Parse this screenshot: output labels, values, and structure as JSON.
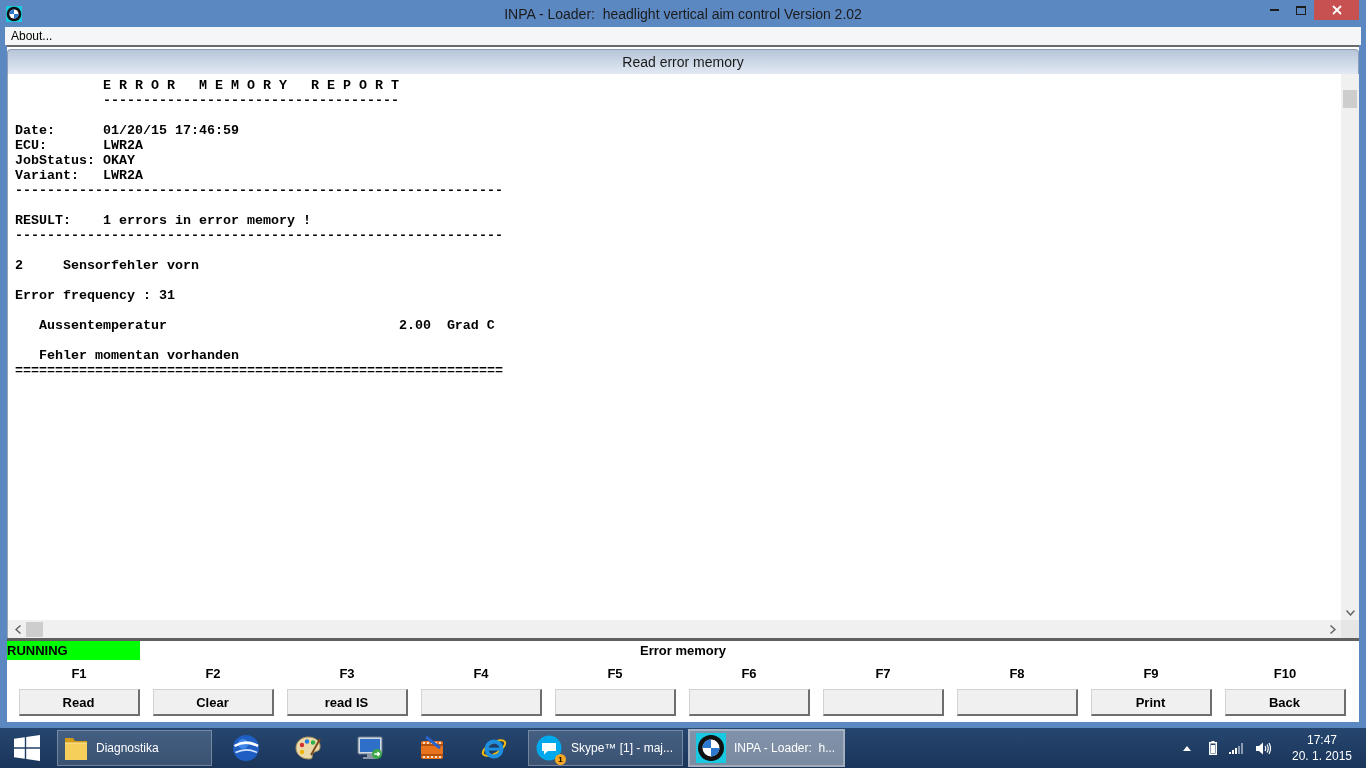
{
  "window": {
    "title": "INPA - Loader:  headlight vertical aim control Version 2.02"
  },
  "menu": [
    "About..."
  ],
  "panel": {
    "title": "Read error memory"
  },
  "report": {
    "title": "E R R O R   M E M O R Y   R E P O R T",
    "title_underline": "-------------------------------------",
    "fields": [
      {
        "label": "Date:",
        "value": "01/20/15 17:46:59"
      },
      {
        "label": "ECU:",
        "value": "LWR2A"
      },
      {
        "label": "JobStatus:",
        "value": "OKAY"
      },
      {
        "label": "Variant:",
        "value": "LWR2A"
      }
    ],
    "separator_1": "-------------------------------------------------------------",
    "result": {
      "label": "RESULT:",
      "value": "1 errors in error memory !"
    },
    "separator_2": "-------------------------------------------------------------",
    "error": {
      "code": "2",
      "name": "Sensorfehler vorn"
    },
    "frequency": "Error frequency : 31",
    "conditions": [
      {
        "name": "Aussentemperatur",
        "value": "2.00",
        "unit": "Grad C"
      }
    ],
    "status": "Fehler momentan vorhanden",
    "end_rule": "============================================================="
  },
  "status_bar": {
    "state": "RUNNING",
    "screen": "Error memory"
  },
  "function_keys": [
    {
      "key": "F1",
      "label": "Read"
    },
    {
      "key": "F2",
      "label": "Clear"
    },
    {
      "key": "F3",
      "label": "read IS"
    },
    {
      "key": "F4"
    },
    {
      "key": "F5"
    },
    {
      "key": "F6"
    },
    {
      "key": "F7"
    },
    {
      "key": "F8"
    },
    {
      "key": "F9",
      "label": "Print"
    },
    {
      "key": "F10",
      "label": "Back"
    }
  ],
  "taskbar": {
    "items": [
      {
        "label": "Diagnostika",
        "running": true,
        "selected": false
      },
      {
        "running": false,
        "selected": false
      },
      {
        "running": false,
        "selected": false
      },
      {
        "running": false,
        "selected": false
      },
      {
        "running": false,
        "selected": false
      },
      {
        "running": false,
        "selected": false
      },
      {
        "label": "Skype™ [1] - maj...",
        "badge": "1",
        "running": true,
        "selected": false
      },
      {
        "label": "INPA - Loader:  h...",
        "running": true,
        "selected": true
      }
    ],
    "clock": {
      "time": "17:47",
      "date": "20. 1. 2015"
    }
  }
}
